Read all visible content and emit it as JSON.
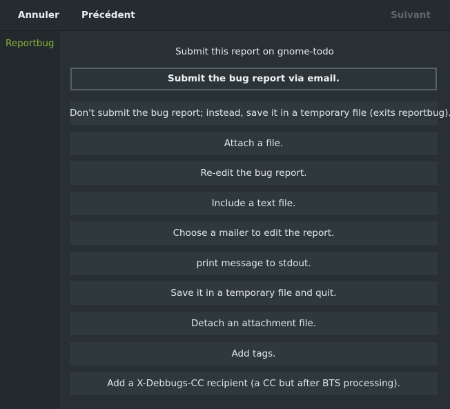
{
  "header": {
    "cancel_label": "Annuler",
    "previous_label": "Précédent",
    "next_label": "Suivant"
  },
  "sidebar": {
    "items": [
      {
        "label": "Reportbug"
      }
    ]
  },
  "main": {
    "heading": "Submit this report on gnome-todo",
    "options": [
      {
        "label": "Submit the bug report via email.",
        "selected": true
      },
      {
        "label": "Don't submit the bug report; instead, save it in a temporary file (exits reportbug)."
      },
      {
        "label": "Attach a file."
      },
      {
        "label": "Re-edit the bug report."
      },
      {
        "label": "Include a text file."
      },
      {
        "label": "Choose a mailer to edit the report."
      },
      {
        "label": "print message to stdout."
      },
      {
        "label": "Save it in a temporary file and quit."
      },
      {
        "label": "Detach an attachment file."
      },
      {
        "label": "Add tags."
      },
      {
        "label": "Add a X-Debbugs-CC recipient (a CC but after BTS processing)."
      }
    ]
  },
  "colors": {
    "accent": "#86b43a",
    "background": "#283034",
    "button": "#2f393d",
    "disabled_text": "#5d6669"
  }
}
